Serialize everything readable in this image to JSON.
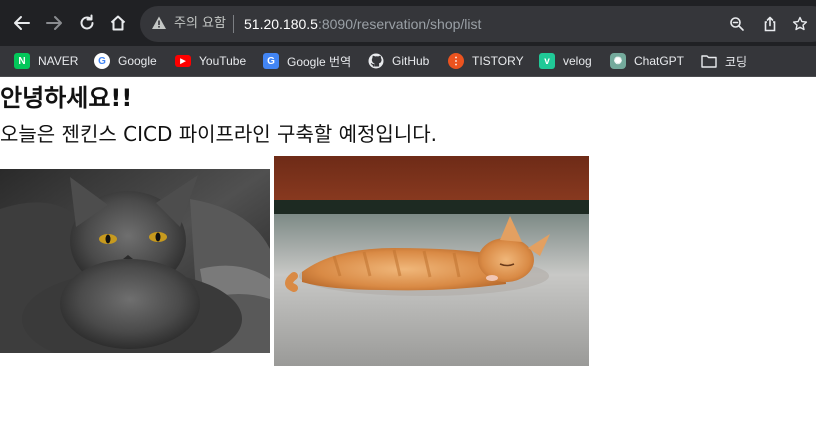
{
  "browser": {
    "security_label": "주의 요함",
    "url_host": "51.20.180.5",
    "url_rest": ":8090/reservation/shop/list"
  },
  "bookmarks": [
    {
      "label": "NAVER",
      "icon": "naver-icon",
      "color": "#03c75a",
      "glyph": "N"
    },
    {
      "label": "Google",
      "icon": "google-icon",
      "color": "#ffffff",
      "glyph": "G"
    },
    {
      "label": "YouTube",
      "icon": "youtube-icon",
      "color": "#ff0000",
      "glyph": "▶"
    },
    {
      "label": "Google 번역",
      "icon": "google-translate-icon",
      "color": "#4285f4",
      "glyph": "G"
    },
    {
      "label": "GitHub",
      "icon": "github-icon",
      "color": "#ffffff",
      "glyph": ""
    },
    {
      "label": "TISTORY",
      "icon": "tistory-icon",
      "color": "#eb531f",
      "glyph": "⋮"
    },
    {
      "label": "velog",
      "icon": "velog-icon",
      "color": "#20c997",
      "glyph": "v"
    },
    {
      "label": "ChatGPT",
      "icon": "chatgpt-icon",
      "color": "#74aa9c",
      "glyph": "✺"
    },
    {
      "label": "코딩",
      "icon": "folder-icon",
      "color": "#e8eaed",
      "glyph": ""
    }
  ],
  "page": {
    "heading": "안녕하세요!!",
    "subheading": "오늘은 젠킨스 CICD 파이프라인 구축할 예정입니다."
  },
  "images": [
    {
      "subject": "gray-cat-photo"
    },
    {
      "subject": "sleeping-orange-kitten-photo"
    }
  ]
}
